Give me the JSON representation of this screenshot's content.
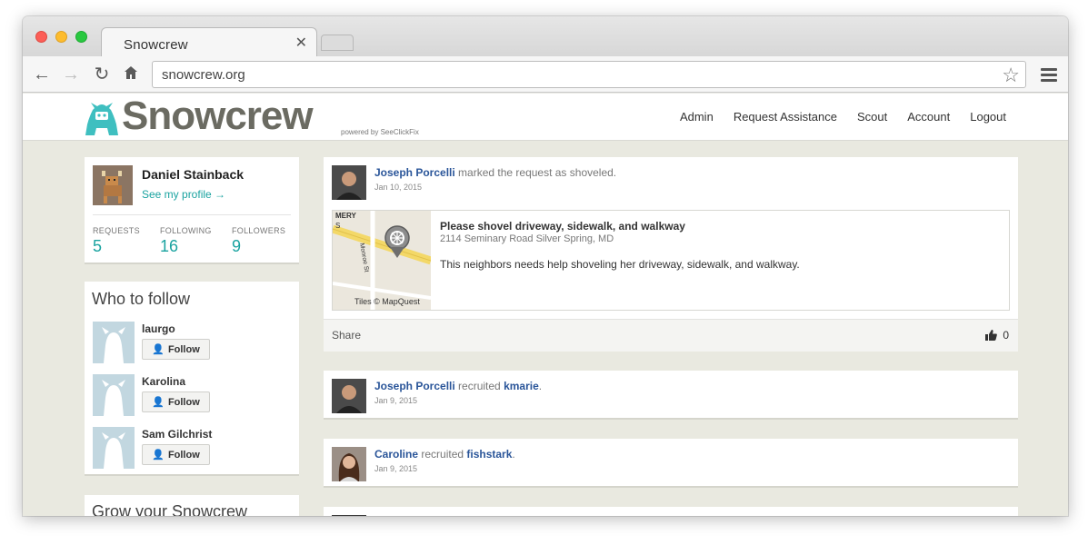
{
  "browser": {
    "tab_title": "Snowcrew",
    "url": "snowcrew.org"
  },
  "site": {
    "logo_text": "Snowcrew",
    "powered_by": "powered by SeeClickFix",
    "nav": [
      "Admin",
      "Request Assistance",
      "Scout",
      "Account",
      "Logout"
    ]
  },
  "profile": {
    "name": "Daniel Stainback",
    "link": "See my profile →",
    "stats": [
      {
        "label": "REQUESTS",
        "value": "5"
      },
      {
        "label": "FOLLOWING",
        "value": "16"
      },
      {
        "label": "FOLLOWERS",
        "value": "9"
      }
    ]
  },
  "who_to_follow": {
    "title": "Who to follow",
    "button_label": "Follow",
    "people": [
      "laurgo",
      "Karolina",
      "Sam Gilchrist"
    ]
  },
  "grow": {
    "title": "Grow your Snowcrew"
  },
  "feed": [
    {
      "actor": "Joseph Porcelli",
      "action": " marked the request as shoveled.",
      "date": "Jan 10, 2015",
      "request": {
        "title": "Please shovel driveway, sidewalk, and walkway",
        "address": "2114 Seminary Road Silver Spring, MD",
        "description": "This neighbors needs help shoveling her driveway, sidewalk, and walkway.",
        "map_credit": "Tiles © MapQuest",
        "map_labels": [
          "MERY",
          "S",
          "Monroe St"
        ]
      },
      "share_label": "Share",
      "likes": "0"
    },
    {
      "actor": "Joseph Porcelli",
      "action": " recruited ",
      "target": "kmarie",
      "suffix": ".",
      "date": "Jan 9, 2015"
    },
    {
      "actor": "Caroline",
      "action": " recruited ",
      "target": "fishstark",
      "suffix": ".",
      "date": "Jan 9, 2015"
    }
  ],
  "colors": {
    "accent": "#1aa3a0",
    "link": "#2a5599",
    "page_bg": "#e9e9e0",
    "logo_gray": "#6b6b62"
  }
}
